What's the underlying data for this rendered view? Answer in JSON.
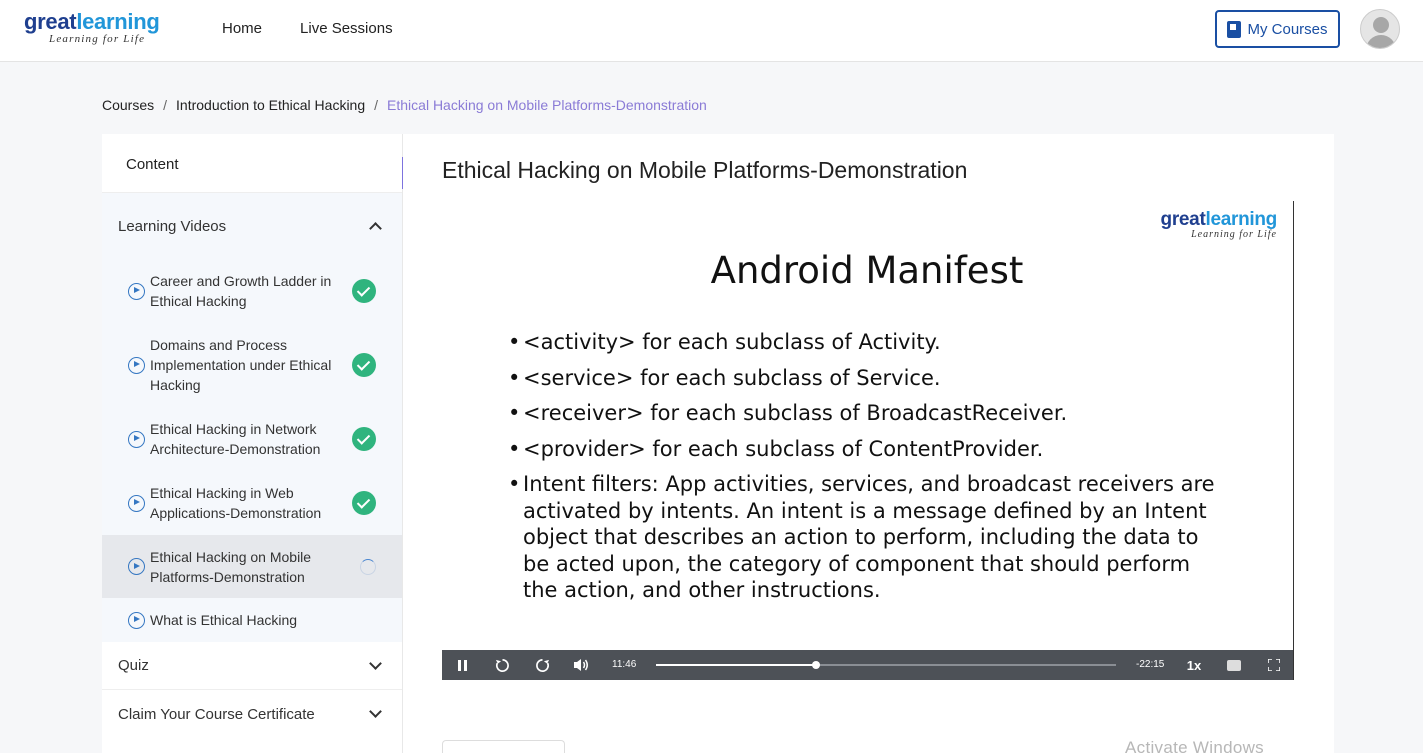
{
  "header": {
    "logo_main_a": "great",
    "logo_main_b": "learning",
    "logo_sub": "Learning for Life",
    "nav": [
      "Home",
      "Live Sessions"
    ],
    "my_courses": "My Courses"
  },
  "breadcrumb": {
    "items": [
      "Courses",
      "Introduction to Ethical Hacking",
      "Ethical Hacking on Mobile Platforms-Demonstration"
    ],
    "separator": "/"
  },
  "sidebar": {
    "heading": "Content",
    "sections": {
      "learning_videos": "Learning Videos",
      "quiz": "Quiz",
      "certificate": "Claim Your Course Certificate"
    },
    "videos": [
      {
        "title": "Career and Growth Ladder in Ethical Hacking",
        "status": "completed"
      },
      {
        "title": "Domains and Process Implementation under Ethical Hacking",
        "status": "completed"
      },
      {
        "title": "Ethical Hacking in Network Architecture-Demonstration",
        "status": "completed"
      },
      {
        "title": "Ethical Hacking in Web Applications-Demonstration",
        "status": "completed"
      },
      {
        "title": "Ethical Hacking on Mobile Platforms-Demonstration",
        "status": "in-progress"
      },
      {
        "title": "What is Ethical Hacking",
        "status": "not-started"
      }
    ]
  },
  "main": {
    "video_title": "Ethical Hacking on Mobile Platforms-Demonstration",
    "slide": {
      "logo_a": "great",
      "logo_b": "learning",
      "logo_sub": "Learning for Life",
      "title": "Android Manifest",
      "bullets": [
        "<activity> for each subclass of Activity.",
        "<service> for each subclass of Service.",
        "<receiver> for each subclass of BroadcastReceiver.",
        "<provider> for each subclass of ContentProvider.",
        "Intent filters: App activities, services, and broadcast receivers are activated by intents. An intent is a message defined by an Intent object that describes an action to perform, including the data to be acted upon, the category of component that should perform the action, and other instructions."
      ]
    },
    "player": {
      "elapsed": "11:46",
      "remaining": "-22:15",
      "progress": 0.347,
      "speed": "1x"
    },
    "watermark": "Activate Windows"
  },
  "colors": {
    "brand_dark": "#1f3f8f",
    "brand_light": "#2196d9",
    "accent_purple": "#7d73de",
    "complete_green": "#2fb47e",
    "player_bar": "#4d5157"
  }
}
